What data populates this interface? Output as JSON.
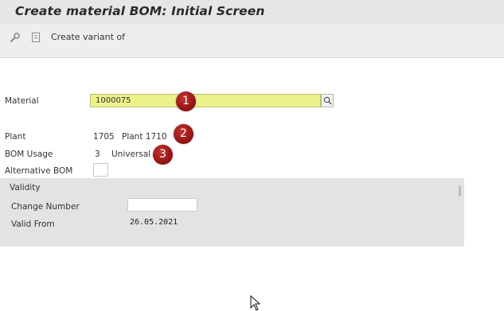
{
  "window": {
    "title": "Create material BOM: Initial Screen"
  },
  "toolbar": {
    "create_variant_label": "Create variant of"
  },
  "form": {
    "material": {
      "label": "Material",
      "value": "1000075"
    },
    "plant": {
      "label": "Plant",
      "value": "1705",
      "description": "Plant 1710"
    },
    "bom_usage": {
      "label": "BOM Usage",
      "value": "3",
      "description": "Universal"
    },
    "alternative_bom": {
      "label": "Alternative BOM",
      "value": ""
    }
  },
  "validity": {
    "title": "Validity",
    "change_number": {
      "label": "Change Number",
      "value": ""
    },
    "valid_from": {
      "label": "Valid From",
      "value": "26.05.2021"
    }
  },
  "annotations": [
    "1",
    "2",
    "3"
  ],
  "colors": {
    "required_field": "#ecf28a",
    "badge": "#a01a1a"
  },
  "icons": [
    "wrench-icon",
    "document-icon",
    "search-help-icon",
    "mouse-cursor-icon"
  ]
}
